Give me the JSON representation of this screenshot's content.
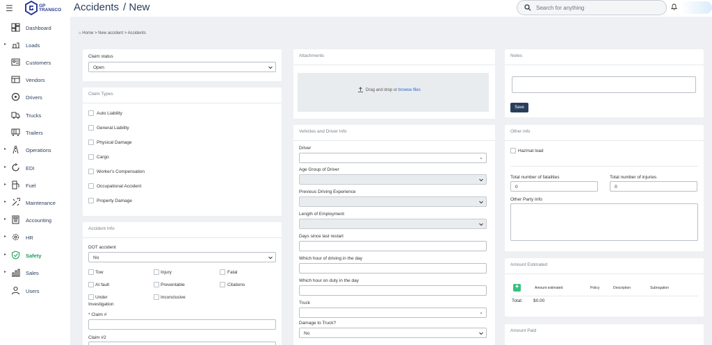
{
  "header": {
    "logo_text_line1": "GP",
    "logo_text_line2": "TRANSCO",
    "title": "Accidents",
    "title_sub": "/ New",
    "search_placeholder": "Search for anything"
  },
  "sidebar": {
    "items": [
      {
        "label": "Dashboard",
        "caret": false,
        "icon": "dashboard-icon"
      },
      {
        "label": "Loads",
        "caret": true,
        "icon": "loads-icon"
      },
      {
        "label": "Customers",
        "caret": false,
        "icon": "customers-icon"
      },
      {
        "label": "Vendors",
        "caret": false,
        "icon": "vendors-icon"
      },
      {
        "label": "Drivers",
        "caret": false,
        "icon": "drivers-icon"
      },
      {
        "label": "Trucks",
        "caret": false,
        "icon": "trucks-icon"
      },
      {
        "label": "Trailers",
        "caret": false,
        "icon": "trailers-icon"
      },
      {
        "label": "Operations",
        "caret": true,
        "icon": "operations-icon"
      },
      {
        "label": "EDI",
        "caret": true,
        "icon": "edi-icon"
      },
      {
        "label": "Fuel",
        "caret": true,
        "icon": "fuel-icon"
      },
      {
        "label": "Maintenance",
        "caret": true,
        "icon": "maintenance-icon"
      },
      {
        "label": "Accounting",
        "caret": true,
        "icon": "accounting-icon"
      },
      {
        "label": "HR",
        "caret": true,
        "icon": "hr-icon"
      },
      {
        "label": "Safety",
        "caret": true,
        "icon": "safety-icon",
        "active": true
      },
      {
        "label": "Sales",
        "caret": true,
        "icon": "sales-icon"
      },
      {
        "label": "Users",
        "caret": false,
        "icon": "users-icon"
      }
    ],
    "active_color": "#1e9e5a"
  },
  "breadcrumb": {
    "home": "Home",
    "sep": ">",
    "level1": "New accident",
    "level2": "Accidents"
  },
  "claim_status": {
    "label": "Claim status",
    "value": "Open"
  },
  "claim_types": {
    "title": "Claim Types",
    "items": [
      "Auto Liability",
      "General Liability",
      "Physical Damage",
      "Cargo",
      "Worker's Compensation",
      "Occupational Accident",
      "Property Damage"
    ]
  },
  "accident_info": {
    "title": "Accident Info",
    "dot_label": "DOT accident",
    "dot_value": "No",
    "checks": {
      "tow": "Tow",
      "injury": "Injury",
      "fatal": "Fatal",
      "at_fault": "At fault",
      "preventable": "Preventable",
      "citations": "Citations",
      "under_investigation_1": "Under",
      "under_investigation_2": "Investigation",
      "inconclusive": "Inconclusive"
    },
    "claim_no_label": "* Claim #",
    "claim_2_label": "Claim #2"
  },
  "attachments": {
    "title": "Attachments",
    "drop_text": "Drag and drop or",
    "browse_link": "browse files"
  },
  "vehicles": {
    "title": "Vehicles and Driver Info",
    "driver_label": "Driver",
    "age_group_label": "Age Group of Driver",
    "previous_exp_label": "Previous Driving Experience",
    "length_emp_label": "Length of Employment",
    "days_restart_label": "Days since last restart",
    "hour_driving_label": "Which hour of driving in the day",
    "hour_duty_label": "Which hour on duty in the day",
    "truck_label": "Truck",
    "damage_truck_label": "Damage to Truck?",
    "damage_truck_value": "No"
  },
  "notes": {
    "title": "Notes",
    "save_label": "Save"
  },
  "other_info": {
    "title": "Other info",
    "hazmat_label": "Hazmat load",
    "fatalities_label": "Total number of fatalities",
    "fatalities_value": "0",
    "injuries_label": "Total number of injuries",
    "injuries_value": "0",
    "other_party_label": "Other Party Info"
  },
  "amount_estimated": {
    "title": "Amount Estimated",
    "columns": [
      "Amount estimated",
      "Policy",
      "Description",
      "Subrogation"
    ],
    "total_label": "Total:",
    "total_value": "$0.00"
  },
  "amount_paid": {
    "title": "Amount Paid"
  }
}
